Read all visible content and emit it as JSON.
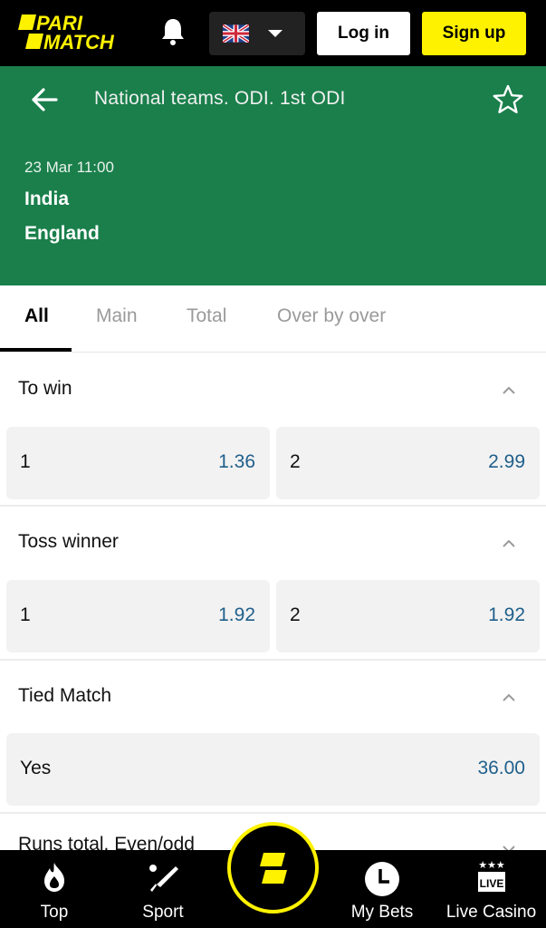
{
  "header": {
    "brand": "PARIMATCH",
    "brand_line1": "PARI",
    "brand_line2": "MATCH",
    "brand_color": "#fff200",
    "language": "EN (UK flag)",
    "login_label": "Log in",
    "signup_label": "Sign up"
  },
  "event": {
    "title": "National teams. ODI. 1st ODI",
    "datetime": "23 Mar 11:00",
    "team1": "India",
    "team2": "England",
    "bg_color": "#1a7f4b"
  },
  "tabs": [
    {
      "label": "All",
      "active": true
    },
    {
      "label": "Main",
      "active": false
    },
    {
      "label": "Total",
      "active": false
    },
    {
      "label": "Over by over",
      "active": false
    }
  ],
  "markets": [
    {
      "title": "To win",
      "expanded": true,
      "outcomes": [
        {
          "label": "1",
          "odds": "1.36"
        },
        {
          "label": "2",
          "odds": "2.99"
        }
      ]
    },
    {
      "title": "Toss winner",
      "expanded": true,
      "outcomes": [
        {
          "label": "1",
          "odds": "1.92"
        },
        {
          "label": "2",
          "odds": "1.92"
        }
      ]
    },
    {
      "title": "Tied Match",
      "expanded": true,
      "outcomes": [
        {
          "label": "Yes",
          "odds": "36.00"
        }
      ]
    },
    {
      "title": "Runs total. Even/odd",
      "expanded": false,
      "outcomes": []
    }
  ],
  "bottom_nav": [
    {
      "label": "Top",
      "icon": "flame-icon"
    },
    {
      "label": "Sport",
      "icon": "cricket-bat-icon"
    },
    {
      "label": "",
      "icon": "parimatch-logo-icon"
    },
    {
      "label": "My Bets",
      "icon": "clock-icon"
    },
    {
      "label": "Live Casino",
      "icon": "live-casino-icon"
    }
  ],
  "colors": {
    "accent_yellow": "#fff200",
    "odds_blue": "#1f5f8b",
    "header_black": "#000000",
    "event_green": "#1a7f4b"
  }
}
